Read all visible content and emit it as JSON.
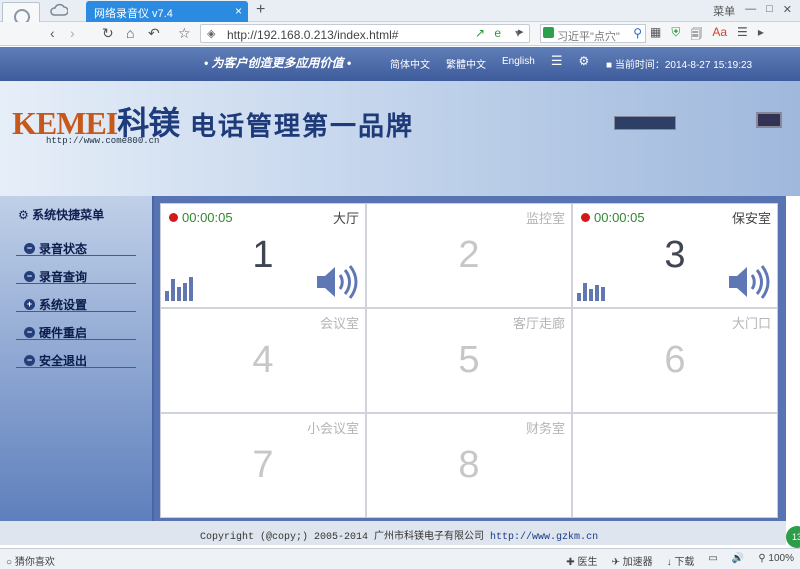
{
  "browser": {
    "tab_title": "网络录音仪 v7.4",
    "tab_close": "×",
    "new_tab": "+",
    "window_controls": [
      "菜单",
      "—",
      "□",
      "✕"
    ],
    "address": "http://192.168.0.213/index.html#",
    "search_text": "习近平\"点穴\""
  },
  "header": {
    "slogan": "• 为客户创造更多应用价值 •",
    "languages": [
      "简体中文",
      "繁體中文",
      "English"
    ],
    "time_label": "当前时间：2014-8-27 15:19:23"
  },
  "banner": {
    "logo_latin": "KEMEI",
    "logo_cn": "科镁",
    "url": "http://www.come800.cn",
    "headline": "电话管理第一品牌"
  },
  "sidebar": {
    "title": "系统快捷菜单",
    "items": [
      {
        "label": "录音状态",
        "icon": "−"
      },
      {
        "label": "录音查询",
        "icon": "−"
      },
      {
        "label": "系统设置",
        "icon": "+"
      },
      {
        "label": "硬件重启",
        "icon": "−"
      },
      {
        "label": "安全退出",
        "icon": "−"
      }
    ]
  },
  "channels": [
    {
      "num": "1",
      "name": "大厅",
      "active": true,
      "timer": "00:00:05"
    },
    {
      "num": "2",
      "name": "监控室",
      "active": false,
      "timer": ""
    },
    {
      "num": "3",
      "name": "保安室",
      "active": true,
      "timer": "00:00:05"
    },
    {
      "num": "4",
      "name": "会议室",
      "active": false,
      "timer": ""
    },
    {
      "num": "5",
      "name": "客厅走廊",
      "active": false,
      "timer": ""
    },
    {
      "num": "6",
      "name": "大门口",
      "active": false,
      "timer": ""
    },
    {
      "num": "7",
      "name": "小会议室",
      "active": false,
      "timer": ""
    },
    {
      "num": "8",
      "name": "财务室",
      "active": false,
      "timer": ""
    },
    {
      "num": "",
      "name": "",
      "active": false,
      "timer": ""
    }
  ],
  "footer": {
    "copyright": "Copyright (@copy;) 2005-2014 广州市科镁电子有限公司",
    "link": "http://www.gzkm.cn"
  },
  "statusbar": {
    "left": "猜你喜欢",
    "right": [
      "医生",
      "加速器",
      "下载",
      "100%"
    ]
  },
  "badge": "13",
  "colors": {
    "tab": "#2b8be0",
    "panel": "#5873b1",
    "rec_dot": "#d31a1a",
    "timer": "#2f8a2f"
  }
}
